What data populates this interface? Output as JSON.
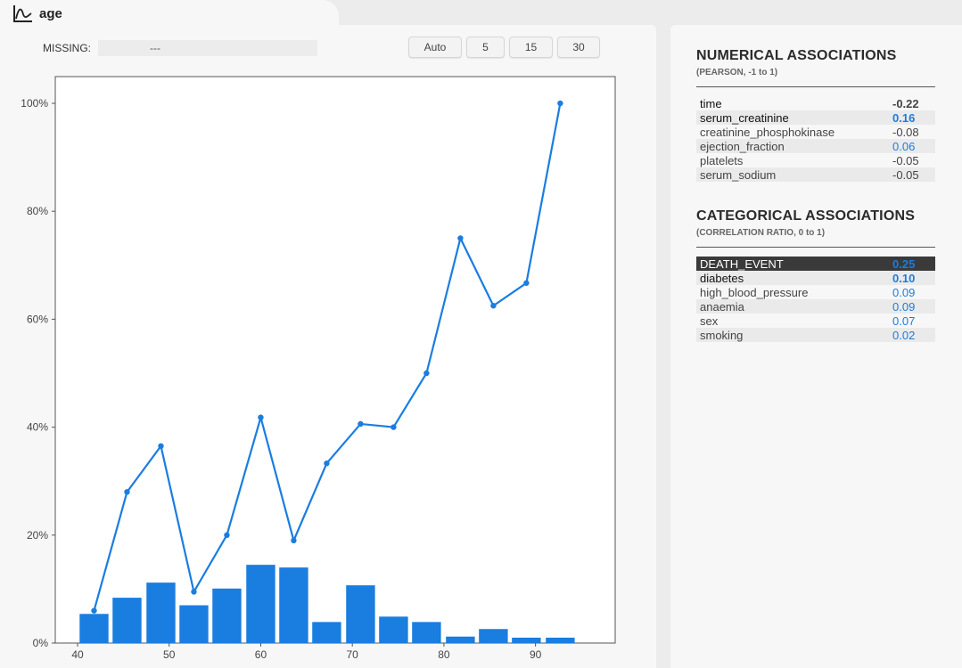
{
  "header": {
    "title": "age",
    "icon": "line-chart-icon"
  },
  "missing": {
    "label": "MISSING:",
    "value": "---"
  },
  "bin_buttons": [
    "Auto",
    "5",
    "15",
    "30"
  ],
  "colors": {
    "accent": "#1a7de0",
    "positive": "#1a7de0",
    "negative": "#444444"
  },
  "chart_data": {
    "type": "bar+line",
    "x_ticks": [
      "40",
      "50",
      "60",
      "70",
      "80",
      "90"
    ],
    "y_ticks": [
      "0%",
      "20%",
      "40%",
      "60%",
      "80%",
      "100%"
    ],
    "xlim": [
      40,
      95
    ],
    "ylim": [
      0,
      100
    ],
    "bin_centers": [
      41.8,
      45.4,
      49.1,
      52.7,
      56.3,
      60.0,
      63.6,
      67.2,
      70.9,
      74.5,
      78.1,
      81.8,
      85.4,
      89.0,
      92.7
    ],
    "bar_values": [
      5.4,
      8.4,
      11.2,
      7.0,
      10.1,
      14.5,
      14.0,
      3.9,
      10.7,
      4.9,
      3.9,
      1.2,
      2.6,
      1.0,
      1.0
    ],
    "line_values": [
      6.0,
      28.0,
      36.5,
      9.5,
      20.0,
      41.8,
      19.0,
      33.3,
      40.6,
      40.0,
      50.0,
      75.0,
      62.5,
      66.7,
      100.0
    ]
  },
  "numerical": {
    "title": "NUMERICAL ASSOCIATIONS",
    "subtitle": "(PEARSON, -1 to 1)",
    "rows": [
      {
        "name": "time",
        "value": "-0.22",
        "strong": true,
        "sign": "neg"
      },
      {
        "name": "serum_creatinine",
        "value": "0.16",
        "strong": true,
        "sign": "pos"
      },
      {
        "name": "creatinine_phosphokinase",
        "value": "-0.08",
        "strong": false,
        "sign": "neg"
      },
      {
        "name": "ejection_fraction",
        "value": "0.06",
        "strong": false,
        "sign": "pos"
      },
      {
        "name": "platelets",
        "value": "-0.05",
        "strong": false,
        "sign": "neg"
      },
      {
        "name": "serum_sodium",
        "value": "-0.05",
        "strong": false,
        "sign": "neg"
      }
    ]
  },
  "categorical": {
    "title": "CATEGORICAL ASSOCIATIONS",
    "subtitle": "(CORRELATION RATIO, 0 to 1)",
    "rows": [
      {
        "name": "DEATH_EVENT",
        "value": "0.25",
        "strong": true,
        "sign": "pos",
        "selected": true
      },
      {
        "name": "diabetes",
        "value": "0.10",
        "strong": true,
        "sign": "pos"
      },
      {
        "name": "high_blood_pressure",
        "value": "0.09",
        "strong": false,
        "sign": "pos"
      },
      {
        "name": "anaemia",
        "value": "0.09",
        "strong": false,
        "sign": "pos"
      },
      {
        "name": "sex",
        "value": "0.07",
        "strong": false,
        "sign": "pos"
      },
      {
        "name": "smoking",
        "value": "0.02",
        "strong": false,
        "sign": "pos"
      }
    ]
  }
}
